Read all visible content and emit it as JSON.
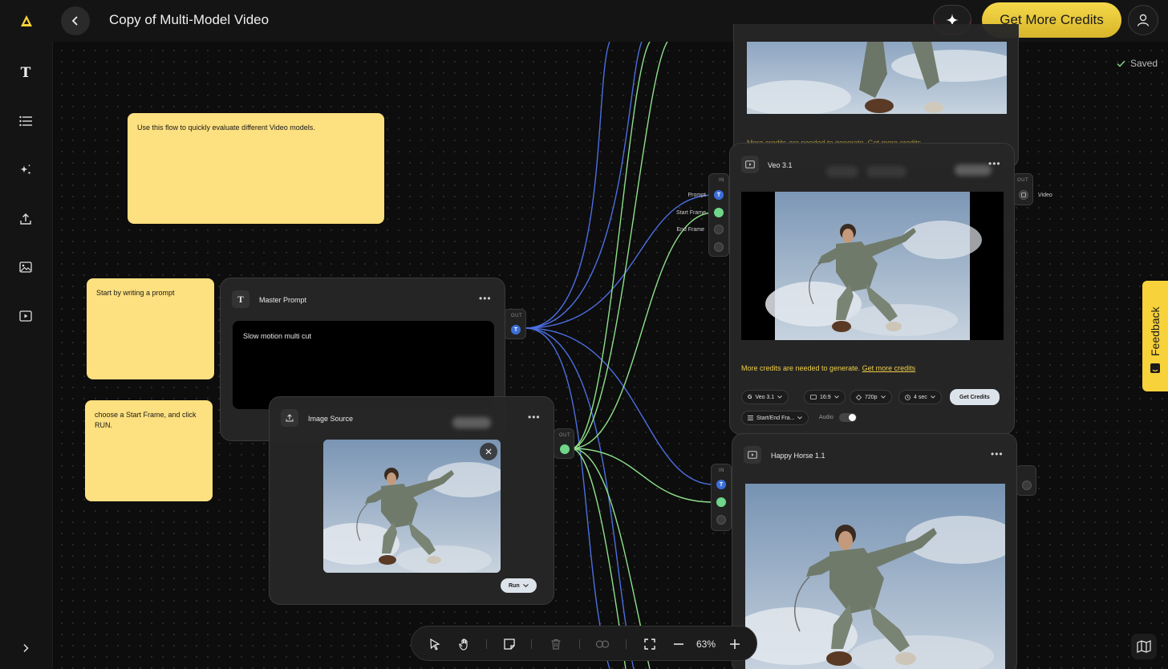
{
  "header": {
    "title": "Copy of Multi-Model Video",
    "credits_button": "Get More Credits"
  },
  "status": {
    "saved": "Saved"
  },
  "stickies": {
    "note1": "Use this flow to quickly evaluate different Video models.",
    "note2": "Start by writing a prompt",
    "note3": "choose a Start Frame, and click RUN."
  },
  "master_prompt": {
    "title": "Master Prompt",
    "text": "Slow motion multi cut",
    "port_out": "OUT",
    "port_type": "T"
  },
  "image_source": {
    "title": "Image Source",
    "port_out": "OUT",
    "run_label": "Run"
  },
  "veo": {
    "title": "Veo 3.1",
    "port_in": "IN",
    "port_out": "OUT",
    "input_prompt": "Prompt",
    "input_start": "Start Frame",
    "input_end": "End Frame",
    "output_label": "Video",
    "credits_msg": "More credits are needed to generate.",
    "credits_link": "Get more credits",
    "chip_model": "Veo 3.1",
    "chip_ratio": "16:9",
    "chip_res": "720p",
    "chip_duration": "4 sec",
    "get_credits": "Get Credits",
    "chip_mode": "Start/End Fra...",
    "audio_label": "Audio",
    "port_type": "T"
  },
  "top_node": {
    "credits_msg": "More credits are needed to generate.",
    "credits_link": "Get more credits"
  },
  "horse": {
    "title": "Happy Horse 1.1",
    "port_in": "IN",
    "port_type": "T"
  },
  "toolbar": {
    "zoom": "63%"
  },
  "feedback": {
    "label": "Feedback"
  },
  "colors": {
    "accent_yellow": "#f7d23a",
    "port_blue": "#3b6fd8",
    "port_green": "#6fd68a",
    "sticky": "#fde07f"
  }
}
